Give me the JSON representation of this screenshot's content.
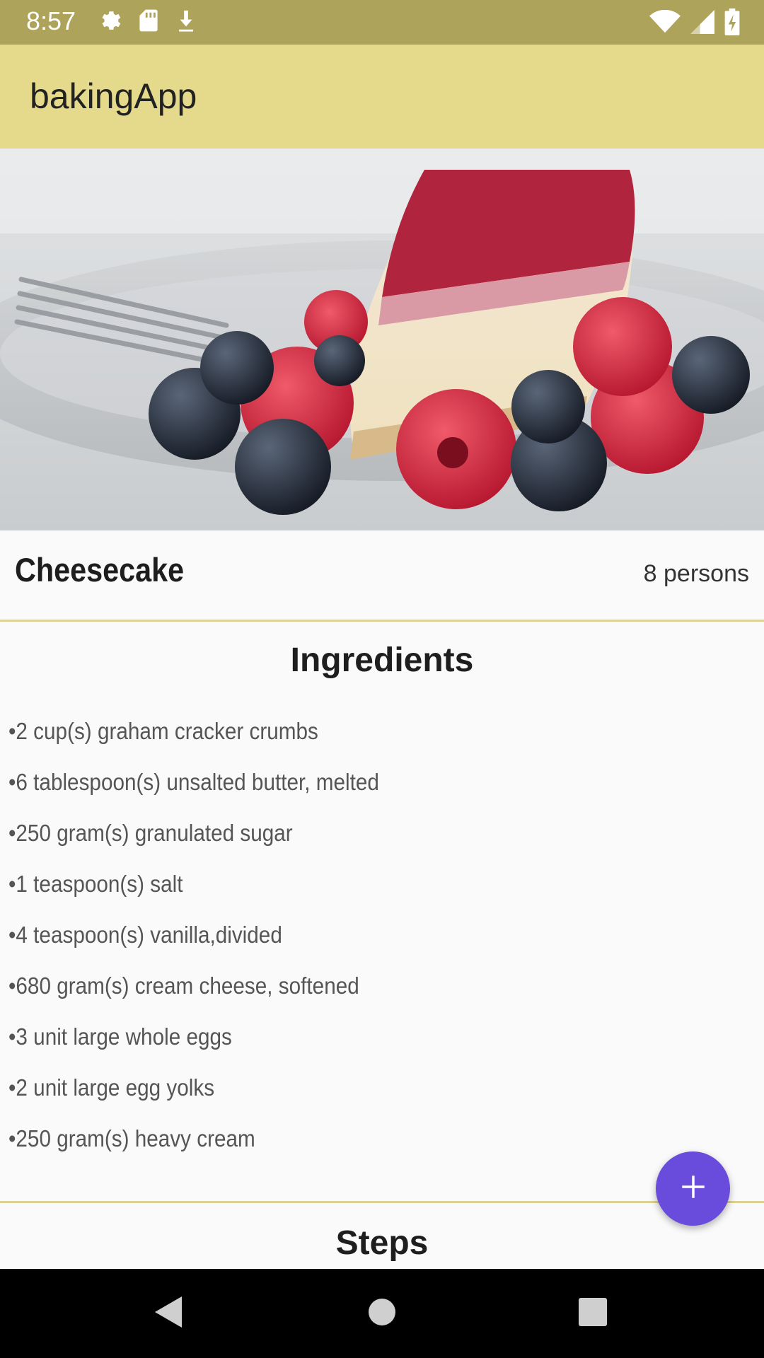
{
  "status_bar": {
    "time": "8:57",
    "left_icons": [
      "settings-icon",
      "sd-card-icon",
      "download-icon"
    ],
    "right_icons": [
      "wifi-icon",
      "signal-icon",
      "battery-icon"
    ],
    "background": "#aea35a"
  },
  "app_bar": {
    "title": "bakingApp",
    "background": "#e5da8b"
  },
  "recipe": {
    "name": "Cheesecake",
    "servings": "8 persons",
    "image": "cheesecake-photo"
  },
  "ingredients": {
    "title": "Ingredients",
    "items": [
      "2 cup(s) graham cracker crumbs",
      "6 tablespoon(s) unsalted butter, melted",
      "250 gram(s) granulated sugar",
      "1 teaspoon(s) salt",
      "4 teaspoon(s) vanilla,divided",
      "680 gram(s) cream cheese, softened",
      "3 unit large whole eggs",
      "2 unit large egg yolks",
      "250 gram(s) heavy cream"
    ]
  },
  "steps": {
    "title": "Steps"
  },
  "fab": {
    "icon": "plus-icon",
    "color": "#6a4cdc"
  },
  "nav_bar": {
    "buttons": [
      "back-icon",
      "home-icon",
      "recents-icon"
    ]
  }
}
